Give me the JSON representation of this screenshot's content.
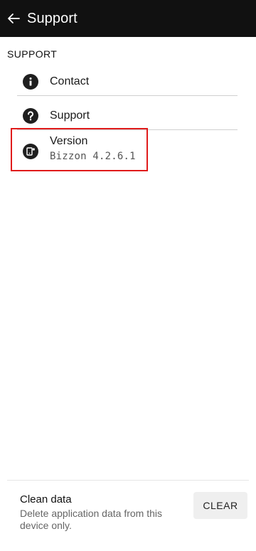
{
  "appbar": {
    "title": "Support",
    "back_icon": "arrow-left-icon",
    "background": "#111111"
  },
  "section": {
    "header": "SUPPORT"
  },
  "items": [
    {
      "icon": "info-icon",
      "label": "Contact"
    },
    {
      "icon": "help-icon",
      "label": "Support"
    },
    {
      "icon": "version-icon",
      "label": "Version",
      "sublabel": "Bizzon 4.2.6.1"
    }
  ],
  "highlight_color": "#e01b1b",
  "clean_data": {
    "title": "Clean data",
    "description": "Delete application data from this device only.",
    "button_label": "CLEAR"
  }
}
